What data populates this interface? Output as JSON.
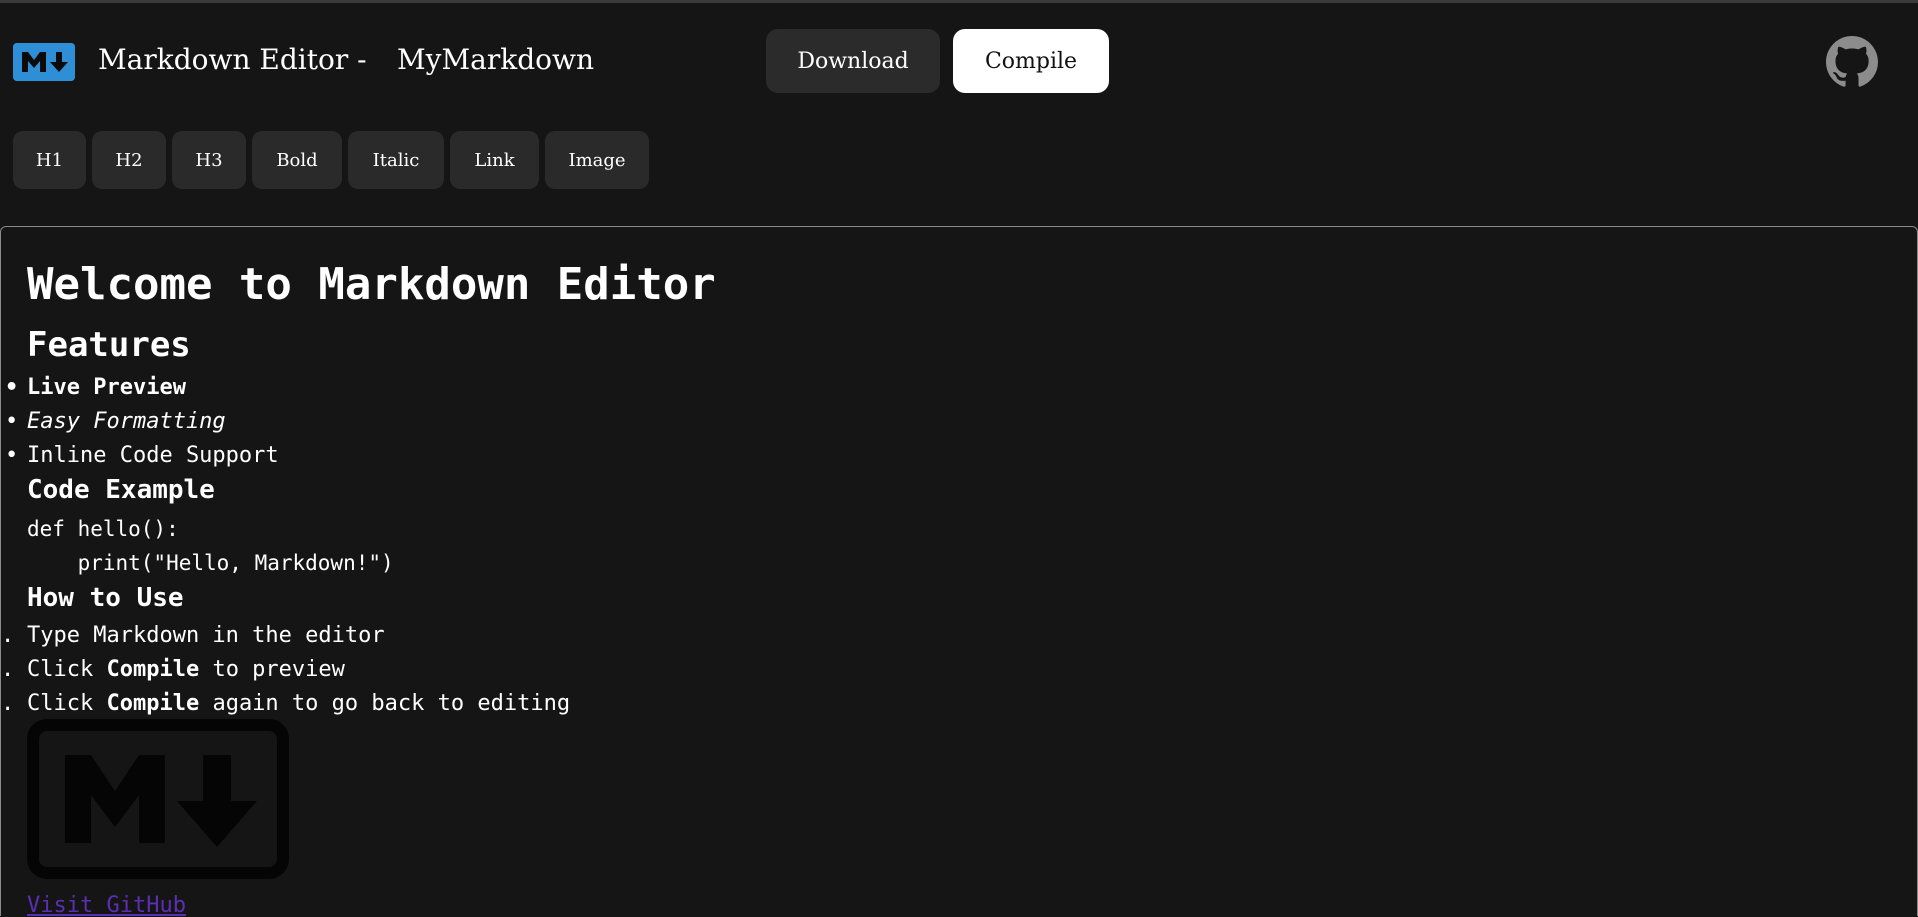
{
  "header": {
    "logo_icon": "markdown-logo-icon",
    "app_title": "Markdown Editor -",
    "doc_name": "MyMarkdown",
    "download_label": "Download",
    "compile_label": "Compile",
    "github_icon": "github-icon"
  },
  "toolbar": {
    "buttons": [
      {
        "label": "H1"
      },
      {
        "label": "H2"
      },
      {
        "label": "H3"
      },
      {
        "label": "Bold"
      },
      {
        "label": "Italic"
      },
      {
        "label": "Link"
      },
      {
        "label": "Image"
      }
    ]
  },
  "preview": {
    "h1": "Welcome to Markdown Editor",
    "features_heading": "Features",
    "features": [
      {
        "text": "Live Preview",
        "style": "bold"
      },
      {
        "text": "Easy Formatting",
        "style": "italic"
      },
      {
        "text": "Inline Code Support",
        "style": "normal"
      }
    ],
    "code_heading": "Code Example",
    "code_lines": [
      "def hello():",
      "    print(\"Hello, Markdown!\")"
    ],
    "howto_heading": "How to Use",
    "steps": [
      {
        "marker": ".",
        "before": "Type Markdown in the editor",
        "bold": "",
        "after": ""
      },
      {
        "marker": ".",
        "before": "Click ",
        "bold": "Compile",
        "after": " to preview"
      },
      {
        "marker": ".",
        "before": "Click ",
        "bold": "Compile",
        "after": " again to go back to editing"
      }
    ],
    "image_icon": "markdown-logo-image",
    "link_text": "Visit GitHub"
  },
  "colors": {
    "background": "#151515",
    "logo_blue": "#2f8fd6",
    "button_dark": "#2b2b2b",
    "button_light": "#ffffff",
    "link": "#5b2fb4"
  }
}
